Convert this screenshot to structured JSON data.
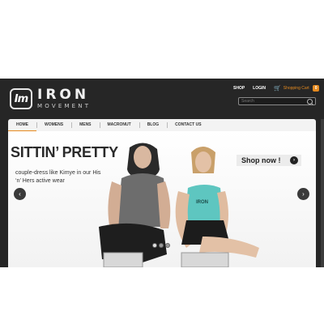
{
  "logo": {
    "mark": "Im",
    "word": "IRON",
    "sub": "MOVEMENT"
  },
  "toplinks": {
    "shop": "SHOP",
    "login": "LOGIN",
    "cart_label": "Shopping Cart",
    "cart_count": "0"
  },
  "search": {
    "placeholder": "Search"
  },
  "nav": {
    "items": [
      "HOME",
      "WOMENS",
      "MENS",
      "MACRONUT",
      "BLOG",
      "CONTACT US"
    ],
    "active": "HOME"
  },
  "hero": {
    "title": "SITTIN’ PRETTY",
    "subtitle": "couple-dress like Kimye in our His ‘n’ Hers active wear",
    "shop_label": "Shop now !",
    "tank_print": "IRON"
  },
  "slider": {
    "slides": 3,
    "active": 0
  },
  "colors": {
    "accent": "#e58a1f",
    "header_bg": "#262626",
    "tank": "#5ec6c0"
  }
}
